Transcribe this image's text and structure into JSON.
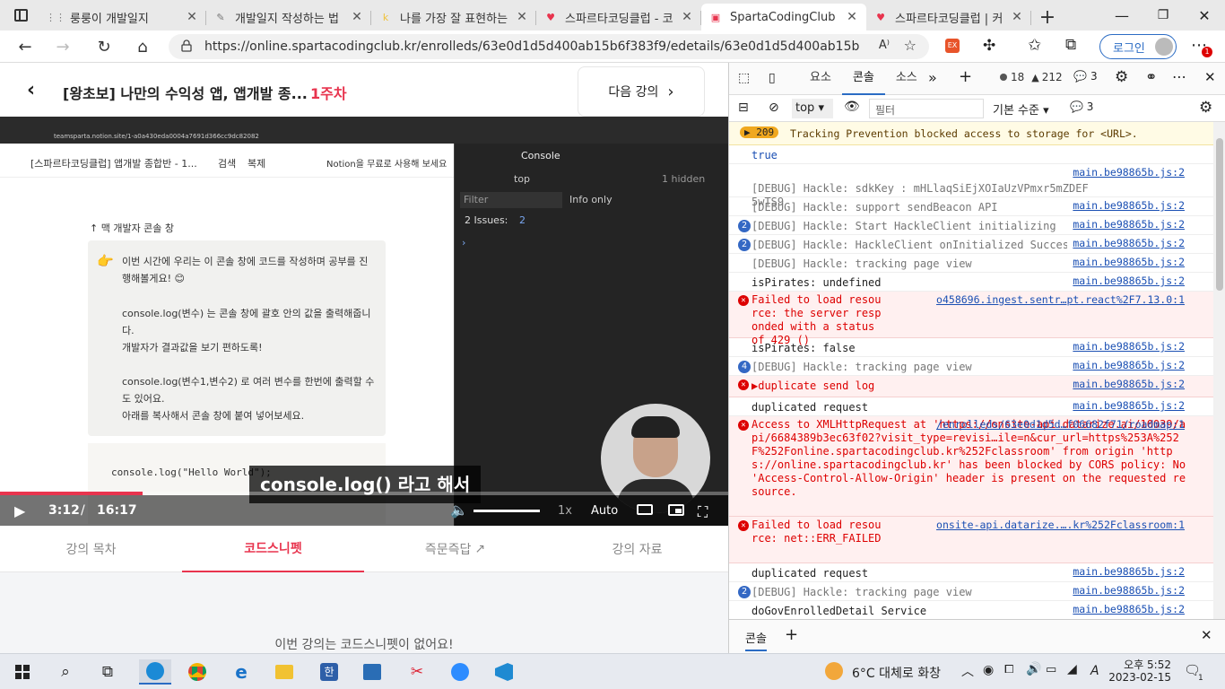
{
  "tabs": [
    {
      "icon": "notion-grid-icon",
      "title": "룽룽이 개발일지",
      "active": false
    },
    {
      "icon": "pen-icon",
      "title": "개발일지 작성하는 법",
      "active": false
    },
    {
      "icon": "k-letter-icon",
      "title": "나를 가장 잘 표현하는",
      "active": false
    },
    {
      "icon": "heart-icon",
      "title": "스파르타코딩클럽 - 코",
      "active": false
    },
    {
      "icon": "sparta-icon",
      "title": "SpartaCodingClub",
      "active": true
    },
    {
      "icon": "heart-icon",
      "title": "스파르타코딩클럽 | 커",
      "active": false
    }
  ],
  "browser": {
    "url": "https://online.spartacodingclub.kr/enrolleds/63e0d1d5d400ab15b6f383f9/edetails/63e0d1d5d400ab15b6f383ff?co...",
    "login_label": "로그인"
  },
  "course": {
    "title": "[왕초보] 나만의 수익성 앱, 앱개발 종...",
    "week": "1주차",
    "next_label": "다음 강의"
  },
  "video": {
    "inner": {
      "url": "teamsparta.notion.site/1-a0a430eda0004a7691d366cc9dc82082",
      "page_title": "[스파르타코딩클럽] 앱개발 종합반 - 1...",
      "search": "검색",
      "copy": "복제",
      "notion_free": "Notion을 무료로 사용해 보세요",
      "mac_console": "↑ 맥 개발자 콘솔 창",
      "callout_1": "이번 시간에 우리는 이 콘솔 창에 코드를 작성하며 공부를 진행해볼게요! 😊",
      "callout_2": "console.log(변수) 는 콘솔 창에 괄호 안의 값을 출력해줍니다.",
      "callout_3": "개발자가 결과값을 보기 편하도록!",
      "callout_4": "console.log(변수1,변수2) 로 여러 변수를 한번에 출력할 수도 있어요.",
      "callout_5": "아래를 복사해서 콘솔 창에 붙여 넣어보세요.",
      "code": "console.log(\"Hello World\");",
      "dt_console": "Console",
      "dt_top": "top",
      "dt_hidden": "1 hidden",
      "dt_filter": "Filter",
      "dt_info": "Info only",
      "dt_issues": "2 Issues:",
      "dt_issue_count": "2"
    },
    "subtitle": "console.log() 라고 해서",
    "time_current": "3:12",
    "time_sep": "/",
    "time_total": "16:17",
    "speed": "1x",
    "quality": "Auto",
    "progress": 0.196
  },
  "lecture_tabs": [
    {
      "label": "강의 목차",
      "active": false
    },
    {
      "label": "코드스니펫",
      "active": true
    },
    {
      "label": "즉문즉답",
      "active": false
    },
    {
      "label": "강의 자료",
      "active": false
    }
  ],
  "no_snippet": "이번 강의는 코드스니펫이 없어요!",
  "devtools": {
    "tabs": [
      "요소",
      "콘솔",
      "소스"
    ],
    "err_count": "18",
    "warn_count": "212",
    "info_count": "3",
    "top": "top",
    "filter_placeholder": "필터",
    "level": "기본 수준",
    "msg_count": "3",
    "tracking_count": "209",
    "tracking": "Tracking Prevention blocked access to storage for <URL>.",
    "rows": [
      {
        "text": "true",
        "src": "",
        "badge": "",
        "type": "val"
      },
      {
        "text": "[DEBUG] Hackle: sdkKey : mHLlaqSiEjXOIaUzVPmxr5mZDEF5wTS9",
        "src": "main.be98865b.js:2",
        "badge": "",
        "type": "debug"
      },
      {
        "text": "[DEBUG] Hackle: support sendBeacon API",
        "src": "main.be98865b.js:2",
        "badge": "",
        "type": "debug"
      },
      {
        "text": "[DEBUG] Hackle: Start HackleClient initializing",
        "src": "main.be98865b.js:2",
        "badge": "2",
        "type": "debug"
      },
      {
        "text": "[DEBUG] Hackle: HackleClient onInitialized Success",
        "src": "main.be98865b.js:2",
        "badge": "2",
        "type": "debug"
      },
      {
        "text": "[DEBUG] Hackle: tracking page view",
        "src": "main.be98865b.js:2",
        "badge": "",
        "type": "debug"
      },
      {
        "text": "isPirates:  undefined",
        "src": "main.be98865b.js:2",
        "badge": "",
        "type": "log"
      },
      {
        "text": "Failed to load resource: the server responded with a status of 429 ()",
        "src": "o458696.ingest.sentr…pt.react%2F7.13.0:1",
        "badge": "",
        "type": "err"
      },
      {
        "text": "isPirates:  false",
        "src": "main.be98865b.js:2",
        "badge": "",
        "type": "log"
      },
      {
        "text": "[DEBUG] Hackle: tracking page view",
        "src": "main.be98865b.js:2",
        "badge": "4",
        "type": "debug"
      },
      {
        "text": "▶duplicate send log",
        "src": "main.be98865b.js:2",
        "badge": "",
        "type": "err"
      },
      {
        "text": "duplicated request",
        "src": "main.be98865b.js:2",
        "badge": "",
        "type": "log"
      },
      {
        "text": "Access to XMLHttpRequest at 'https://onsite-api.datarize.ai/10039/api/6684389b3ec63f02?visit_type=revisi…ile=n&cur_url=https%253A%252F%252Fonline.spartacodingclub.kr%252Fclassroom' from origin 'https://online.spartacodingclub.kr' has been blocked by CORS policy: No 'Access-Control-Allow-Origin' header is present on the requested resource.",
        "src": "/enrolleds/63e0d1d5d…f06682f71/roadmap:1",
        "badge": "",
        "type": "err"
      },
      {
        "text": "Failed to load resource: net::ERR_FAILED",
        "src": "onsite-api.datarize.….kr%252Fclassroom:1",
        "badge": "",
        "type": "err"
      },
      {
        "text": "duplicated request",
        "src": "main.be98865b.js:2",
        "badge": "",
        "type": "log"
      },
      {
        "text": "[DEBUG] Hackle: tracking page view",
        "src": "main.be98865b.js:2",
        "badge": "2",
        "type": "debug"
      },
      {
        "text": "doGovEnrolledDetail Service",
        "src": "main.be98865b.js:2",
        "badge": "",
        "type": "log"
      }
    ],
    "drawer_tab": "콘솔"
  },
  "taskbar": {
    "weather": "6°C  대체로 화창",
    "ime": "A",
    "time": "오후 5:52",
    "date": "2023-02-15",
    "notif": "1"
  }
}
